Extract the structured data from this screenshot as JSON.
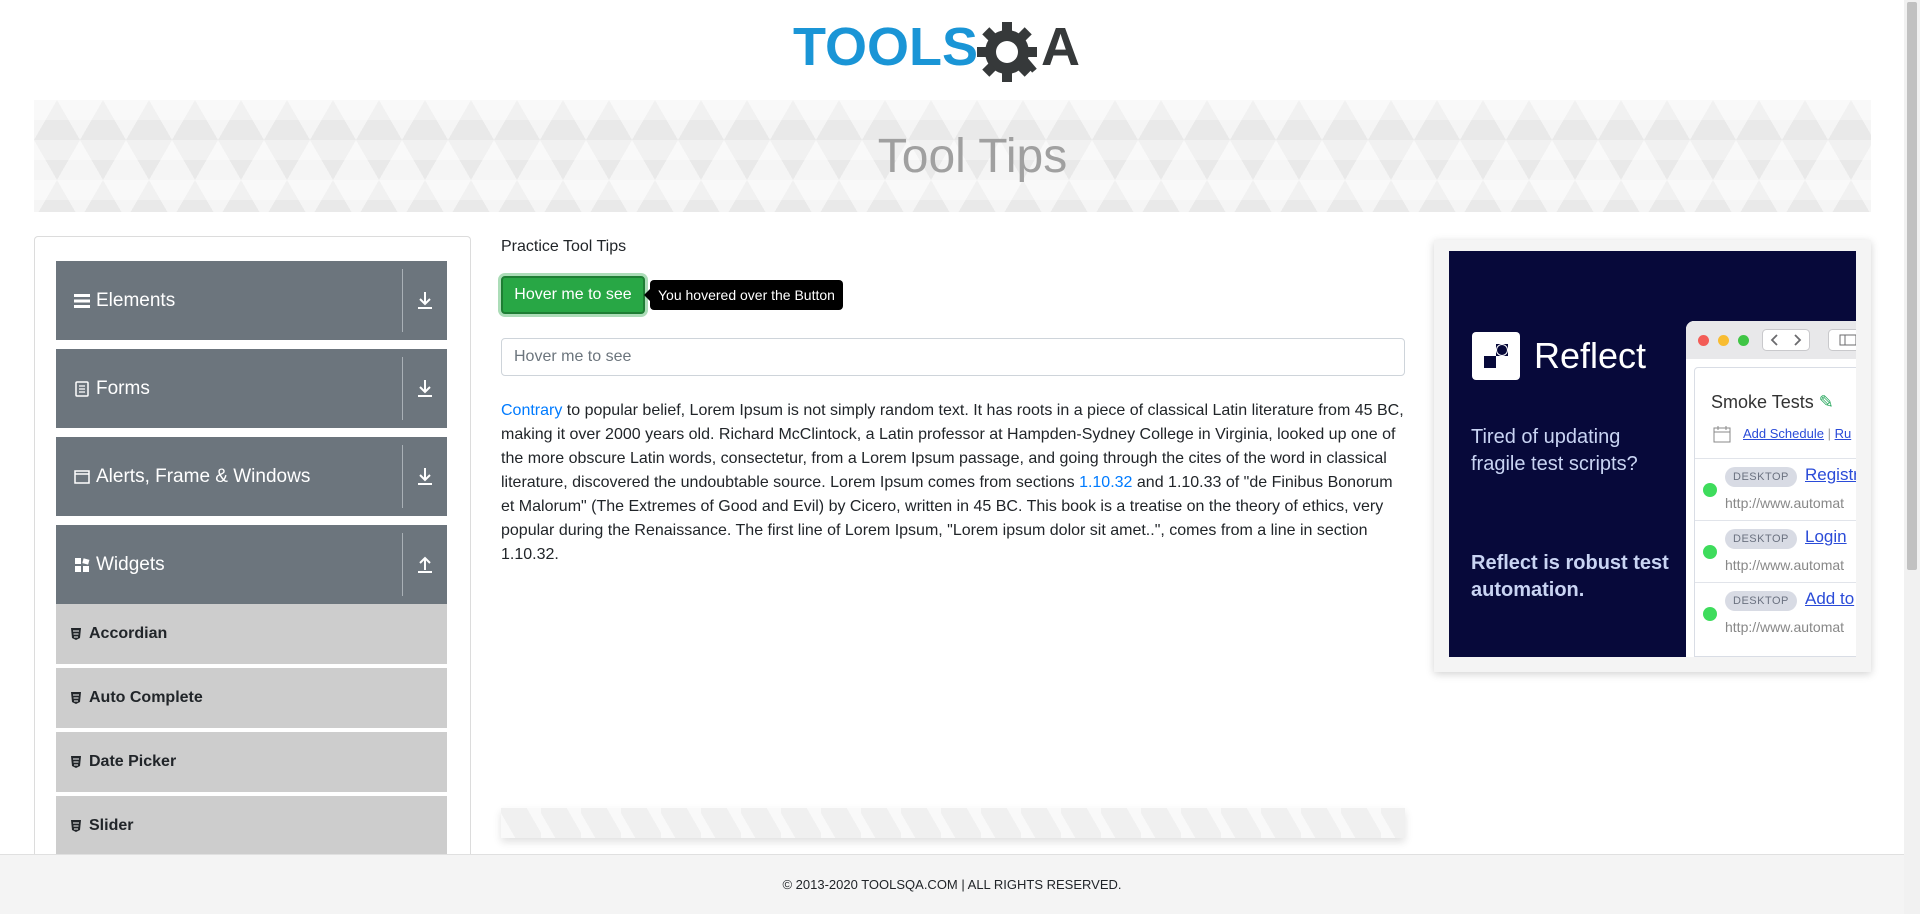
{
  "logo": {
    "text_tools": "TOOLS",
    "text_qa": "A",
    "color_blue": "#1a95d6",
    "color_dark": "#36393a"
  },
  "banner": {
    "title": "Tool Tips"
  },
  "sidebar": {
    "groups": [
      {
        "label": "Elements",
        "icon": "hamburger-icon",
        "state": "collapsed"
      },
      {
        "label": "Forms",
        "icon": "document-icon",
        "state": "collapsed"
      },
      {
        "label": "Alerts, Frame & Windows",
        "icon": "window-icon",
        "state": "collapsed"
      },
      {
        "label": "Widgets",
        "icon": "widgets-icon",
        "state": "expanded"
      }
    ],
    "widget_items": [
      {
        "label": "Accordian"
      },
      {
        "label": "Auto Complete"
      },
      {
        "label": "Date Picker"
      },
      {
        "label": "Slider"
      }
    ]
  },
  "main": {
    "title": "Practice Tool Tips",
    "button_label": "Hover me to see",
    "tooltip_text": "You hovered over the Button",
    "input_placeholder": "Hover me to see",
    "para_link1": "Contrary",
    "para_part1": " to popular belief, Lorem Ipsum is not simply random text. It has roots in a piece of classical Latin literature from 45 BC, making it over 2000 years old. Richard McClintock, a Latin professor at Hampden-Sydney College in Virginia, looked up one of the more obscure Latin words, consectetur, from a Lorem Ipsum passage, and going through the cites of the word in classical literature, discovered the undoubtable source. Lorem Ipsum comes from sections ",
    "para_link2": "1.10.32",
    "para_part2": " and 1.10.33 of \"de Finibus Bonorum et Malorum\" (The Extremes of Good and Evil) by Cicero, written in 45 BC. This book is a treatise on the theory of ethics, very popular during the Renaissance. The first line of Lorem Ipsum, \"Lorem ipsum dolor sit amet..\", comes from a line in section 1.10.32."
  },
  "ad": {
    "brand": "Reflect",
    "text1": "Tired of updating fragile test scripts?",
    "text2": "Reflect is robust test automation.",
    "window_title": "Smoke Tests",
    "add_schedule": "Add Schedule",
    "run_link": "Ru",
    "rows": [
      {
        "tag": "DESKTOP",
        "link": "Registr",
        "url": "http://www.automat"
      },
      {
        "tag": "DESKTOP",
        "link": "Login",
        "url": "http://www.automat"
      },
      {
        "tag": "DESKTOP",
        "link": "Add to",
        "url": "http://www.automat"
      }
    ]
  },
  "footer": {
    "text": "© 2013-2020 TOOLSQA.COM | ALL RIGHTS RESERVED."
  }
}
